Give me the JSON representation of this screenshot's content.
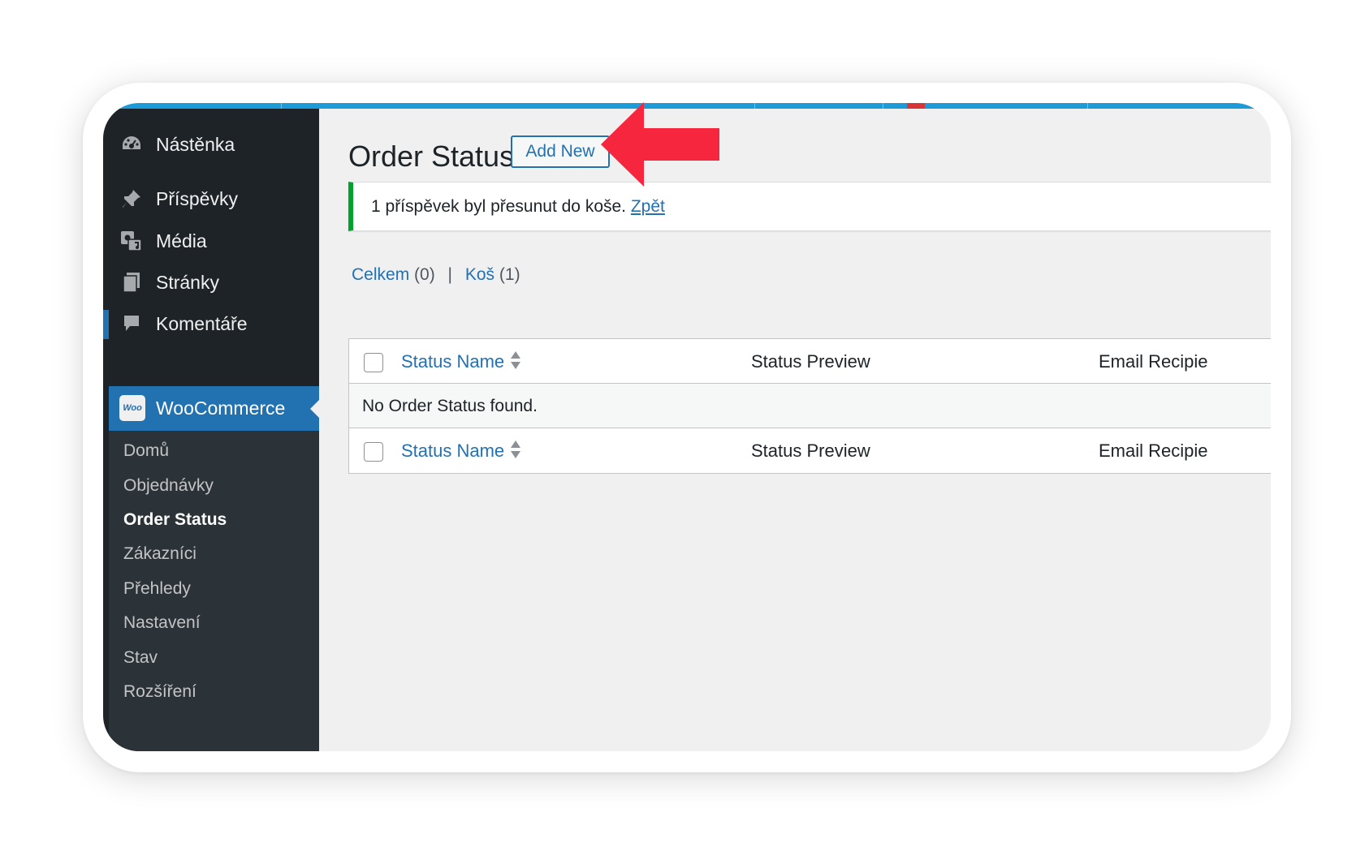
{
  "sidebar": {
    "items": [
      {
        "label": "Nástěnka",
        "icon": "dashboard-icon"
      },
      {
        "label": "Příspěvky",
        "icon": "pin-icon"
      },
      {
        "label": "Média",
        "icon": "media-icon"
      },
      {
        "label": "Stránky",
        "icon": "pages-icon"
      },
      {
        "label": "Komentáře",
        "icon": "comments-icon"
      }
    ],
    "woocommerce": {
      "label": "WooCommerce",
      "icon_text": "Woo"
    },
    "submenu": [
      "Domů",
      "Objednávky",
      "Order Status",
      "Zákazníci",
      "Přehledy",
      "Nastavení",
      "Stav",
      "Rozšíření"
    ],
    "current_submenu": "Order Status"
  },
  "header": {
    "title": "Order Status",
    "add_new": "Add New"
  },
  "notice": {
    "message": "1 příspěvek byl přesunut do koše.",
    "undo": "Zpět"
  },
  "views": [
    {
      "label": "Celkem",
      "count": "(0)"
    },
    {
      "label": "Koš",
      "count": "(1)"
    }
  ],
  "views_separator": "|",
  "table": {
    "columns": [
      "Status Name",
      "Status Preview",
      "Email Recipie"
    ],
    "empty_message": "No Order Status found."
  },
  "colors": {
    "admin_dark": "#1d2327",
    "admin_blue": "#2271b1",
    "notice_green": "#00a32a",
    "arrow_red": "#f7263f"
  }
}
